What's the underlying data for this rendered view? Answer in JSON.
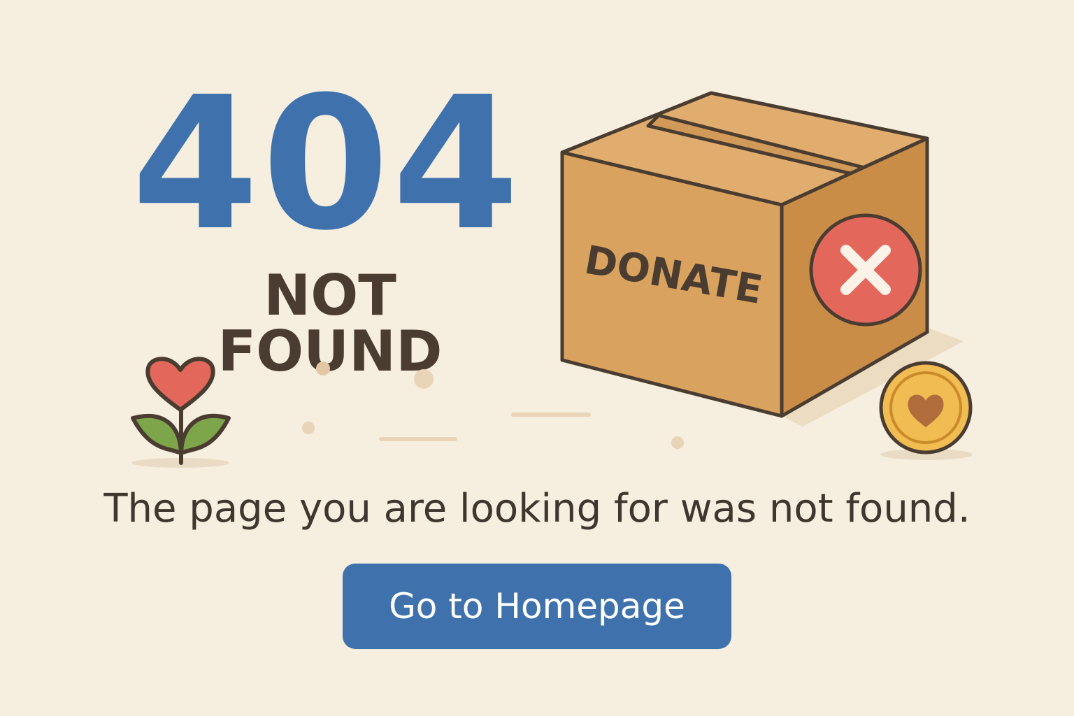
{
  "error": {
    "code": "404",
    "title": "NOT FOUND",
    "message": "The page you are looking for was not found."
  },
  "illustration": {
    "box_label": "DONATE",
    "icons": [
      "heart-flower-icon",
      "donation-box-icon",
      "error-x-icon",
      "heart-coin-icon"
    ]
  },
  "actions": {
    "home_label": "Go to Homepage"
  },
  "colors": {
    "background": "#f6eedf",
    "accent": "#3f72ad",
    "text": "#4a3c30",
    "error": "#e4675b",
    "box": "#d9a35f"
  }
}
